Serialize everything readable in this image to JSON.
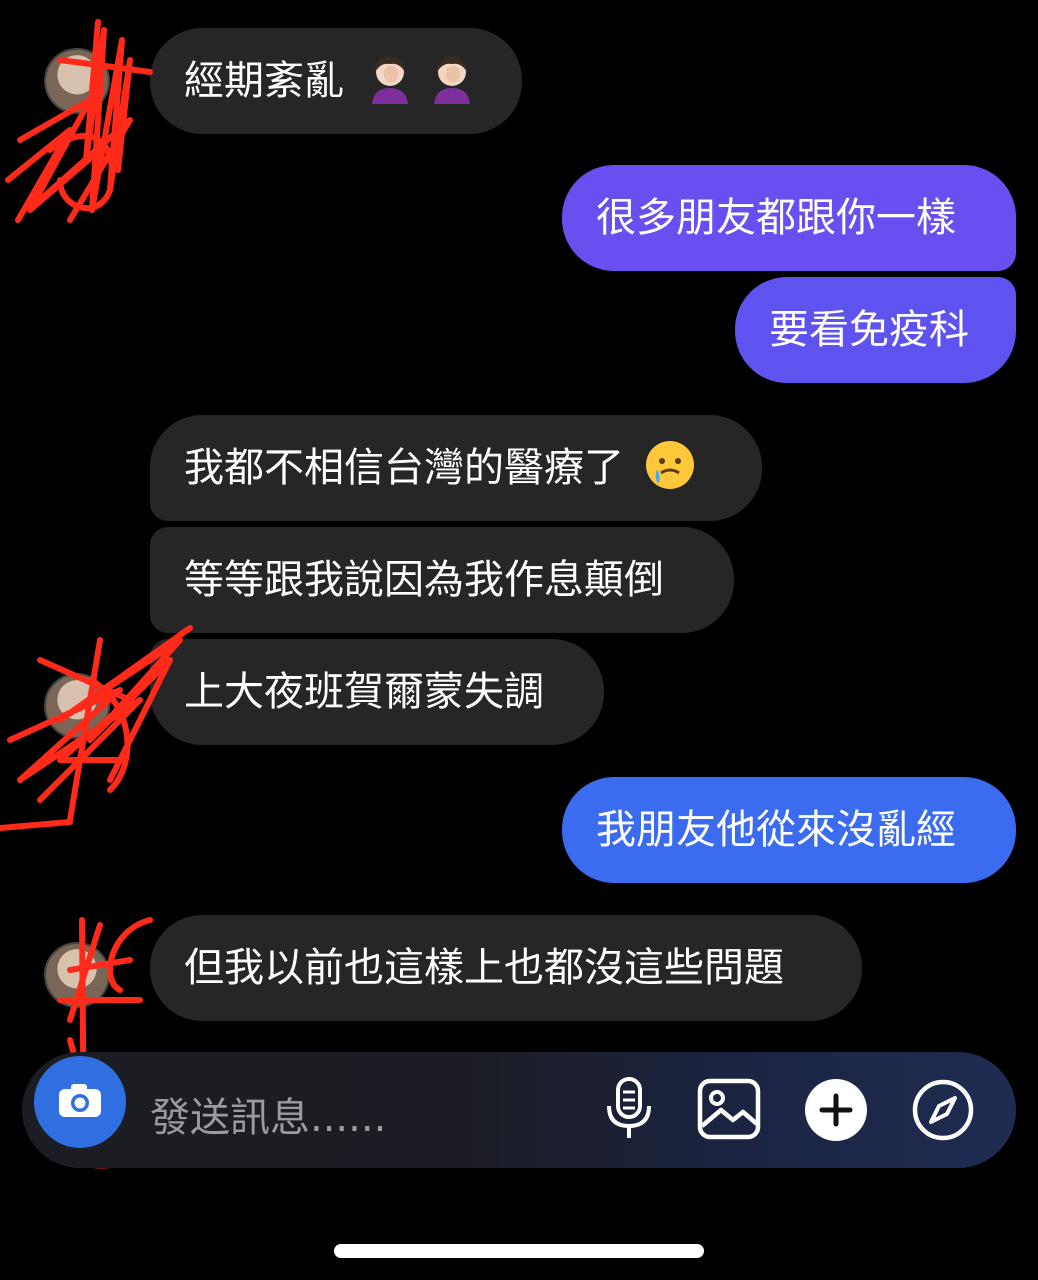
{
  "messages": [
    {
      "id": "m1",
      "side": "in",
      "text": "經期紊亂",
      "emoji": "facepalm-woman-icon x2"
    },
    {
      "id": "m2",
      "side": "out",
      "text": "很多朋友都跟你一樣"
    },
    {
      "id": "m3",
      "side": "out",
      "text": "要看免疫科"
    },
    {
      "id": "m4",
      "side": "in",
      "text": "我都不相信台灣的醫療了",
      "emoji": "crying-smile-icon"
    },
    {
      "id": "m5",
      "side": "in",
      "text": "等等跟我說因為我作息顛倒"
    },
    {
      "id": "m6",
      "side": "in",
      "text": "上大夜班賀爾蒙失調"
    },
    {
      "id": "m7",
      "side": "out",
      "text": "我朋友他從來沒亂經"
    },
    {
      "id": "m8",
      "side": "in",
      "text": "但我以前也這樣上也都沒這些問題"
    }
  ],
  "composer": {
    "placeholder": "發送訊息......",
    "icons": [
      "camera-icon",
      "microphone-icon",
      "image-icon",
      "plus-icon",
      "compass-icon"
    ]
  },
  "colors": {
    "incoming_bubble": "#262626",
    "outgoing_purple": "#6a4ff0",
    "outgoing_blue": "#3b6cf0",
    "scribble": "#ff2a1a",
    "camera_button": "#2f6fdf"
  }
}
